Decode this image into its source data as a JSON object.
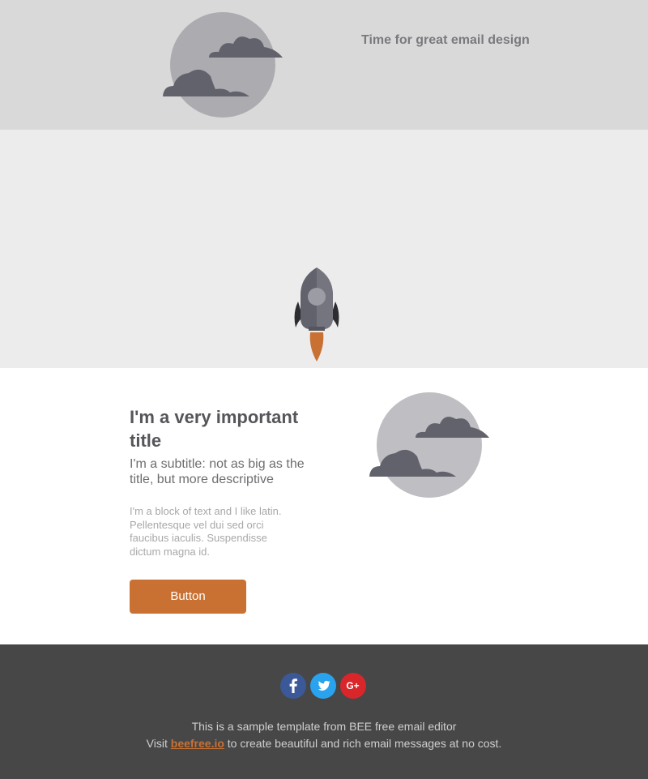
{
  "header": {
    "tagline": "Time for great email design",
    "illustration_icon": "moon-with-clouds-icon"
  },
  "hero": {
    "rocket_icon": "rocket-icon",
    "clouds_icon": "clouds-icon"
  },
  "content": {
    "title": "I'm a very important title",
    "subtitle": "I'm a subtitle: not as big as the title, but more descriptive",
    "paragraph": "I'm a block of text and I like latin. Pellentesque vel dui sed orci faucibus iaculis. Suspendisse dictum magna id.",
    "button_label": "Button",
    "illustration_icon": "moon-with-clouds-icon"
  },
  "footer": {
    "social": [
      {
        "name": "facebook",
        "icon": "facebook-icon",
        "glyph": "f",
        "color": "#3b5998"
      },
      {
        "name": "twitter",
        "icon": "twitter-icon",
        "color": "#2aa3ef"
      },
      {
        "name": "google-plus",
        "icon": "google-plus-icon",
        "glyph": "G+",
        "color": "#d9262b"
      }
    ],
    "line1": "This is a sample template from BEE free email editor",
    "line2_prefix": "Visit",
    "link_text": "beefree.io",
    "line2_suffix": "to create beautiful and rich email messages at no cost."
  },
  "colors": {
    "header_bg": "#d9d9d9",
    "hero_bg": "#ececec",
    "cloud_dark": "#62626d",
    "accent": "#c97132",
    "footer_bg": "#474747"
  }
}
